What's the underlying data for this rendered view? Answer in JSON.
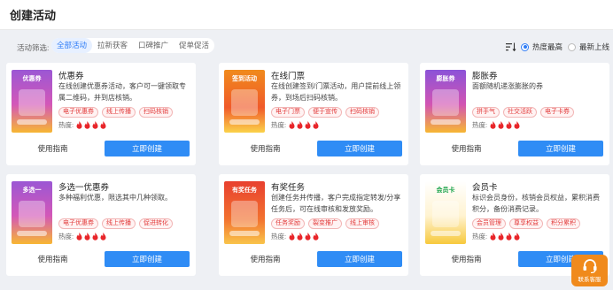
{
  "header": {
    "title": "创建活动"
  },
  "filters": {
    "label": "活动筛选:",
    "tabs": [
      "全部活动",
      "拉新获客",
      "口碑推广",
      "促单促活"
    ],
    "active_index": 0
  },
  "sort": {
    "options": [
      "热度最高",
      "最新上线"
    ],
    "selected_index": 0
  },
  "heat_label": "热度:",
  "buttons": {
    "guide": "使用指南",
    "create": "立即创建"
  },
  "colors": {
    "primary": "#2f8cf5",
    "flame": "#e8262a",
    "tag_text": "#e23b3b",
    "support": "#f08a1c"
  },
  "cards": [
    {
      "title": "优惠券",
      "desc": "在线创建优惠券活动，客户可一键领取专属二维码，并到店核销。",
      "tags": [
        "电子优惠券",
        "线上传播",
        "扫码核销"
      ],
      "heat": 4,
      "thumb_text": "优惠券",
      "thumb_sub": ""
    },
    {
      "title": "在线门票",
      "desc": "在线创建签到/门票活动，用户提前线上领券，到场后扫码核销。",
      "tags": [
        "电子门票",
        "便于宣传",
        "扫码核销"
      ],
      "heat": 4,
      "thumb_text": "签到活动",
      "thumb_sub": ""
    },
    {
      "title": "膨胀券",
      "desc": "面额随机递涨膨胀的券",
      "tags": [
        "拼手气",
        "社交活跃",
        "电子卡券"
      ],
      "heat": 4,
      "thumb_text": "膨胀券",
      "thumb_sub": ""
    },
    {
      "title": "多选一优惠券",
      "desc": "多种福利优惠，限选其中几种领取。",
      "tags": [
        "电子优惠券",
        "线上传播",
        "促进转化"
      ],
      "heat": 4,
      "thumb_text": "多选一",
      "thumb_sub": ""
    },
    {
      "title": "有奖任务",
      "desc": "创建任务并传播，客户完成指定转发/分享任务后，可在线审核和发放奖励。",
      "tags": [
        "任务奖励",
        "裂变推广",
        "线上审核"
      ],
      "heat": 4,
      "thumb_text": "有奖任务",
      "thumb_sub": ""
    },
    {
      "title": "会员卡",
      "desc": "标识会员身份，核销会员权益，累积消费积分，备份消费记录。",
      "tags": [
        "会员管理",
        "尊享权益",
        "积分累积"
      ],
      "heat": 4,
      "thumb_text": "会员卡",
      "thumb_sub": ""
    }
  ],
  "support": {
    "label": "联系客服"
  }
}
